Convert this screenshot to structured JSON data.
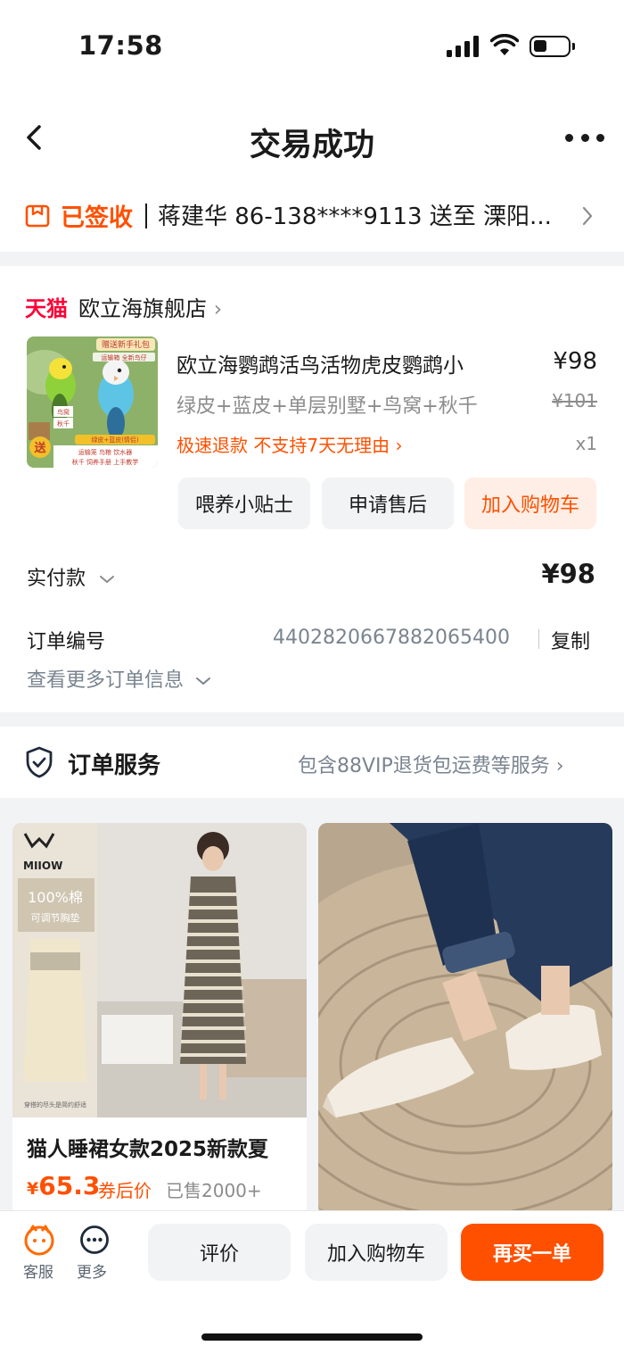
{
  "status_bar": {
    "time": "17:58"
  },
  "nav": {
    "title": "交易成功"
  },
  "delivery": {
    "status": "已签收",
    "info": "蒋建华 86-138****9113 送至 溧阳..."
  },
  "store": {
    "platform": "天猫",
    "name": "欧立海旗舰店"
  },
  "product": {
    "title": "欧立海鹦鹉活鸟活物虎皮鹦鹉小",
    "price": "¥98",
    "sku": "绿皮+蓝皮+单层别墅+鸟窝+秋千",
    "original_price": "¥101",
    "tags": "极速退款 不支持7天无理由 ›",
    "quantity": "x1",
    "image_texts": [
      "赠送新手礼包",
      "运输箱 全新鸟仔",
      "鸟窝",
      "秋千",
      "送",
      "绿皮+蓝皮(情侣)",
      "运输笼 鸟粮 饮水器",
      "秋千 饲养手册 上手教学"
    ]
  },
  "product_actions": {
    "tips": "喂养小贴士",
    "after_sales": "申请售后",
    "add_cart": "加入购物车"
  },
  "payment": {
    "label": "实付款",
    "value": "¥98"
  },
  "order": {
    "number_label": "订单编号",
    "number": "4402820667882065400",
    "copy": "复制",
    "more_info": "查看更多订单信息"
  },
  "service": {
    "title": "订单服务",
    "desc": "包含88VIP退货包运费等服务"
  },
  "recommend": [
    {
      "brand": "MIIOW",
      "badge": "100%棉",
      "sub_badge": "可调节胸垫",
      "caption": "穿搭的尽头是简约舒适",
      "title": "猫人睡裙女款2025新款夏",
      "price_symbol": "¥",
      "price": "65.3",
      "coupon": "券后价",
      "sold": "已售2000+"
    },
    {
      "title": ""
    }
  ],
  "bottom": {
    "cs_label": "客服",
    "more_label": "更多",
    "review": "评价",
    "add_cart": "加入购物车",
    "buy_again": "再买一单"
  }
}
